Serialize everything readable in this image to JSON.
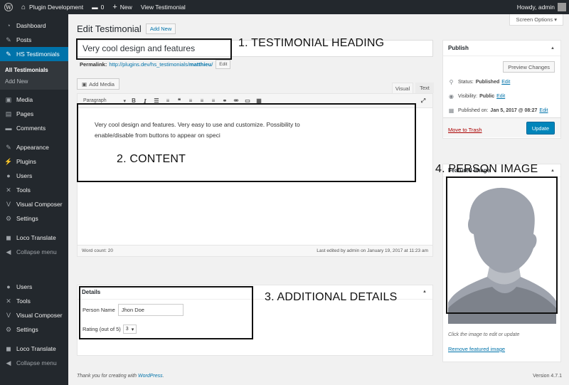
{
  "adminbar": {
    "site_name": "Plugin Development",
    "comments_count": "0",
    "new_label": "New",
    "view_label": "View Testimonial",
    "howdy": "Howdy, admin"
  },
  "sidebar": {
    "items_top": [
      {
        "label": "Dashboard",
        "icon": "dashboard-icon",
        "glyph": "◔"
      },
      {
        "label": "Posts",
        "icon": "pushpin-icon",
        "glyph": "✎"
      },
      {
        "label": "HS Testimonials",
        "icon": "pushpin-icon",
        "glyph": "✎"
      }
    ],
    "submenu": [
      "All Testimonials",
      "Add New"
    ],
    "items_mid": [
      {
        "label": "Media",
        "icon": "media-icon",
        "glyph": "▣"
      },
      {
        "label": "Pages",
        "icon": "page-icon",
        "glyph": "▤"
      },
      {
        "label": "Comments",
        "icon": "comment-icon",
        "glyph": "▬"
      },
      {
        "label": "Appearance",
        "icon": "brush-icon",
        "glyph": "✎"
      },
      {
        "label": "Plugins",
        "icon": "plugin-icon",
        "glyph": "⚡"
      },
      {
        "label": "Users",
        "icon": "users-icon",
        "glyph": "●"
      },
      {
        "label": "Tools",
        "icon": "wrench-icon",
        "glyph": "✕"
      },
      {
        "label": "Visual Composer",
        "icon": "visual-composer-icon",
        "glyph": "V"
      },
      {
        "label": "Settings",
        "icon": "settings-icon",
        "glyph": "⚙"
      },
      {
        "label": "Loco Translate",
        "icon": "translate-icon",
        "glyph": "◼"
      },
      {
        "label": "Collapse menu",
        "icon": "collapse-icon",
        "glyph": "◀"
      }
    ],
    "items_bottom": [
      {
        "label": "Users",
        "icon": "users-icon",
        "glyph": "●"
      },
      {
        "label": "Tools",
        "icon": "wrench-icon",
        "glyph": "✕"
      },
      {
        "label": "Visual Composer",
        "icon": "visual-composer-icon",
        "glyph": "V"
      },
      {
        "label": "Settings",
        "icon": "settings-icon",
        "glyph": "⚙"
      },
      {
        "label": "Loco Translate",
        "icon": "translate-icon",
        "glyph": "◼"
      },
      {
        "label": "Collapse menu",
        "icon": "collapse-icon",
        "glyph": "◀"
      }
    ]
  },
  "header": {
    "screen_options": "Screen Options ▾",
    "title": "Edit Testimonial",
    "add_new": "Add New"
  },
  "post": {
    "title": "Very cool design and features",
    "permalink_label": "Permalink:",
    "permalink_base": "http://plugins.dev/hs_testimonials/",
    "permalink_slug": "matthieu",
    "permalink_trail": "/",
    "permalink_edit": "Edit"
  },
  "editor": {
    "add_media": "Add Media",
    "tab_visual": "Visual",
    "tab_text": "Text",
    "format_select": "Paragraph",
    "content": "Very cool design and features. Very easy to use and customize. Possibility to enable/disable from buttons to appear on speci",
    "word_count": "Word count: 20",
    "last_edited": "Last edited by admin on January 19, 2017 at 11:23 am"
  },
  "details": {
    "heading": "Details",
    "name_label": "Person Name",
    "name_value": "Jhon Doe",
    "rating_label": "Rating (out of 5)",
    "rating_value": "3"
  },
  "publish": {
    "heading": "Publish",
    "preview": "Preview Changes",
    "status_label": "Status:",
    "status_value": "Published",
    "visibility_label": "Visibility:",
    "visibility_value": "Public",
    "published_label": "Published on:",
    "published_value": "Jan 5, 2017 @ 08:27",
    "edit": "Edit",
    "trash": "Move to Trash",
    "update": "Update"
  },
  "featured": {
    "heading": "Featured Image",
    "caption": "Click the image to edit or update",
    "remove": "Remove featured image"
  },
  "footer": {
    "thanks_prefix": "Thank you for creating with ",
    "thanks_link": "WordPress",
    "thanks_suffix": ".",
    "version": "Version 4.7.1"
  },
  "annotations": {
    "heading": "1. TESTIMONIAL HEADING",
    "content": "2. CONTENT",
    "details": "3. ADDITIONAL DETAILS",
    "image": "4. PERSON IMAGE"
  }
}
